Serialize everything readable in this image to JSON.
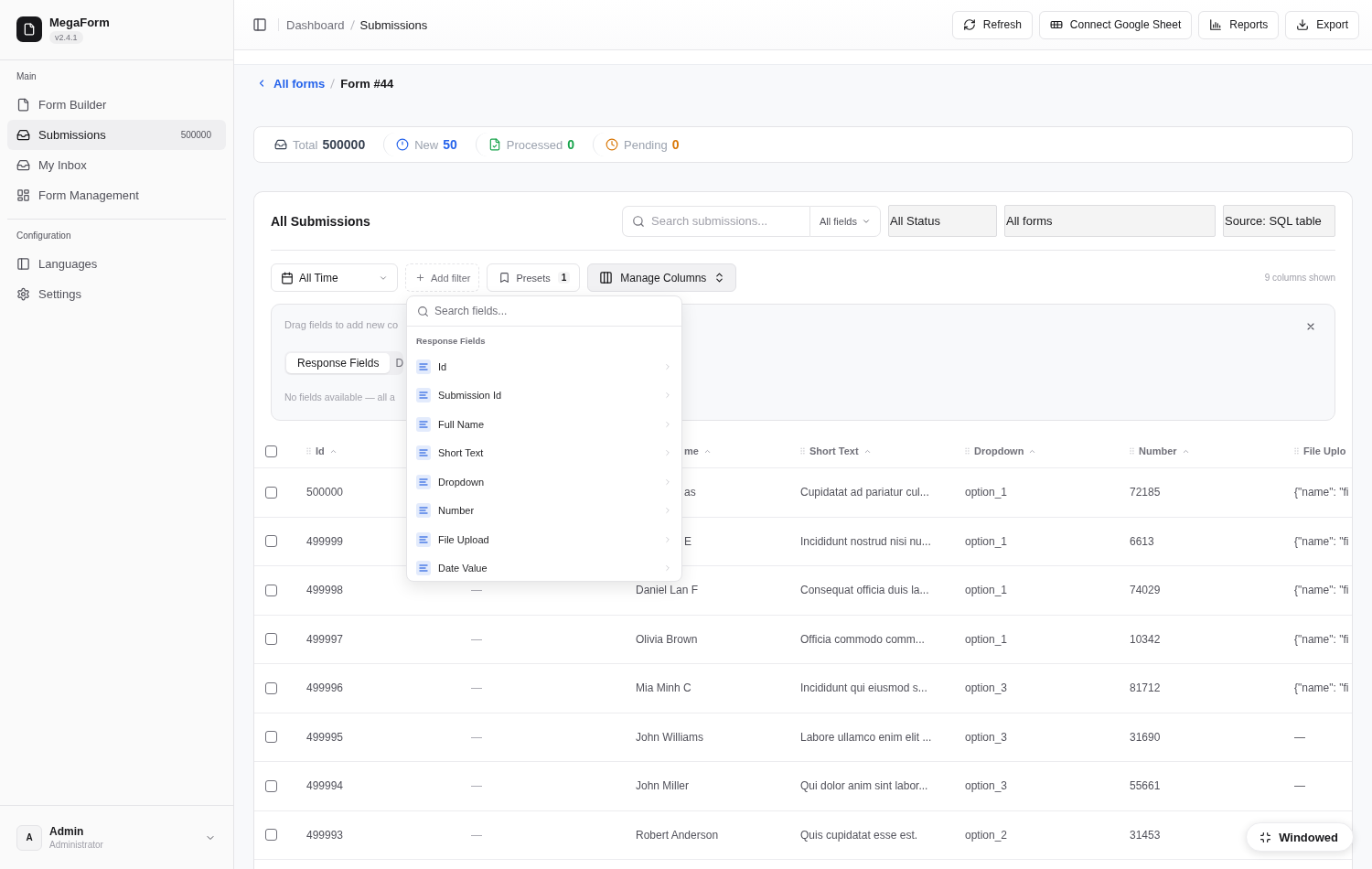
{
  "sidebar": {
    "app_name": "MegaForm",
    "version": "v2.4.1",
    "sections": [
      {
        "title": "Main",
        "items": [
          {
            "label": "Form Builder",
            "selected": false
          },
          {
            "label": "Submissions",
            "selected": true,
            "count": "500000"
          },
          {
            "label": "My Inbox",
            "selected": false
          },
          {
            "label": "Form Management",
            "selected": false
          }
        ]
      },
      {
        "title": "Configuration",
        "items": [
          {
            "label": "Languages",
            "selected": false
          },
          {
            "label": "Settings",
            "selected": false
          }
        ]
      }
    ],
    "user": {
      "initial": "A",
      "name": "Admin",
      "role": "Administrator"
    }
  },
  "topbar": {
    "breadcrumb": [
      "Dashboard",
      "Submissions"
    ],
    "buttons": [
      "Refresh",
      "Connect Google Sheet",
      "Reports",
      "Export"
    ]
  },
  "page_breadcrumb": {
    "back": "All forms",
    "current": "Form #44"
  },
  "stats": [
    {
      "label": "Total",
      "value": "500000",
      "color": "#374151"
    },
    {
      "label": "New",
      "value": "50",
      "color": "#2563eb"
    },
    {
      "label": "Processed",
      "value": "0",
      "color": "#16a34a"
    },
    {
      "label": "Pending",
      "value": "0",
      "color": "#d97706"
    }
  ],
  "submissions": {
    "title": "All Submissions",
    "search": {
      "placeholder": "Search submissions...",
      "scope": "All fields"
    },
    "filters": [
      "All Status",
      "All forms",
      "Source: SQL table"
    ],
    "toolbar": {
      "date_range": "All Time",
      "add_filter": "Add filter",
      "presets": {
        "label": "Presets",
        "count": "1"
      },
      "manage_columns": {
        "label": "Manage Columns",
        "expanded": true
      },
      "columns_shown": "9 columns shown"
    },
    "column_panel": {
      "hint": "Drag fields to add new co",
      "tabs": [
        {
          "label": "Response Fields",
          "selected": true
        },
        {
          "label": "D",
          "selected": false
        }
      ],
      "empty_text": "No fields available — all a"
    },
    "table": {
      "select_all_checked": false,
      "columns": {
        "id": "Id",
        "column_3": "me",
        "short_text": "Short Text",
        "dropdown": "Dropdown",
        "number": "Number",
        "column_7": "File Uplo"
      },
      "rows": [
        {
          "selected": false,
          "cells": {
            "id": "500000",
            "column_3": "as",
            "short_text": "Cupidatat ad pariatur cul...",
            "dropdown": "option_1",
            "number": "72185",
            "column_7": "{\"name\": \"fi"
          }
        },
        {
          "selected": false,
          "cells": {
            "id": "499999",
            "column_3": "E",
            "short_text": "Incididunt nostrud nisi nu...",
            "dropdown": "option_1",
            "number": "6613",
            "column_7": "{\"name\": \"fi"
          }
        },
        {
          "selected": false,
          "cells": {
            "id": "499998",
            "column_2": "—",
            "column_3": "Daniel Lan F",
            "short_text": "Consequat officia duis la...",
            "dropdown": "option_1",
            "number": "74029",
            "column_7": "{\"name\": \"fi"
          }
        },
        {
          "selected": false,
          "cells": {
            "id": "499997",
            "column_2": "—",
            "column_3": "Olivia Brown",
            "short_text": "Officia commodo comm...",
            "dropdown": "option_1",
            "number": "10342",
            "column_7": "{\"name\": \"fi"
          }
        },
        {
          "selected": false,
          "cells": {
            "id": "499996",
            "column_2": "—",
            "column_3": "Mia Minh C",
            "short_text": "Incididunt qui eiusmod s...",
            "dropdown": "option_3",
            "number": "81712",
            "column_7": "{\"name\": \"fi"
          }
        },
        {
          "selected": false,
          "cells": {
            "id": "499995",
            "column_2": "—",
            "column_3": "John Williams",
            "short_text": "Labore ullamco enim elit ...",
            "dropdown": "option_3",
            "number": "31690",
            "column_7": "—"
          }
        },
        {
          "selected": false,
          "cells": {
            "id": "499994",
            "column_2": "—",
            "column_3": "John Miller",
            "short_text": "Qui dolor anim sint labor...",
            "dropdown": "option_3",
            "number": "55661",
            "column_7": "—"
          }
        },
        {
          "selected": false,
          "cells": {
            "id": "499993",
            "column_2": "—",
            "column_3": "Robert Anderson",
            "short_text": "Quis cupidatat esse est.",
            "dropdown": "option_2",
            "number": "31453"
          }
        }
      ]
    }
  },
  "field_menu": {
    "placeholder": "Search fields...",
    "section": "Response Fields",
    "items": [
      "Id",
      "Submission Id",
      "Full Name",
      "Short Text",
      "Dropdown",
      "Number",
      "File Upload",
      "Date Value"
    ]
  },
  "window_mode_button": "Windowed"
}
